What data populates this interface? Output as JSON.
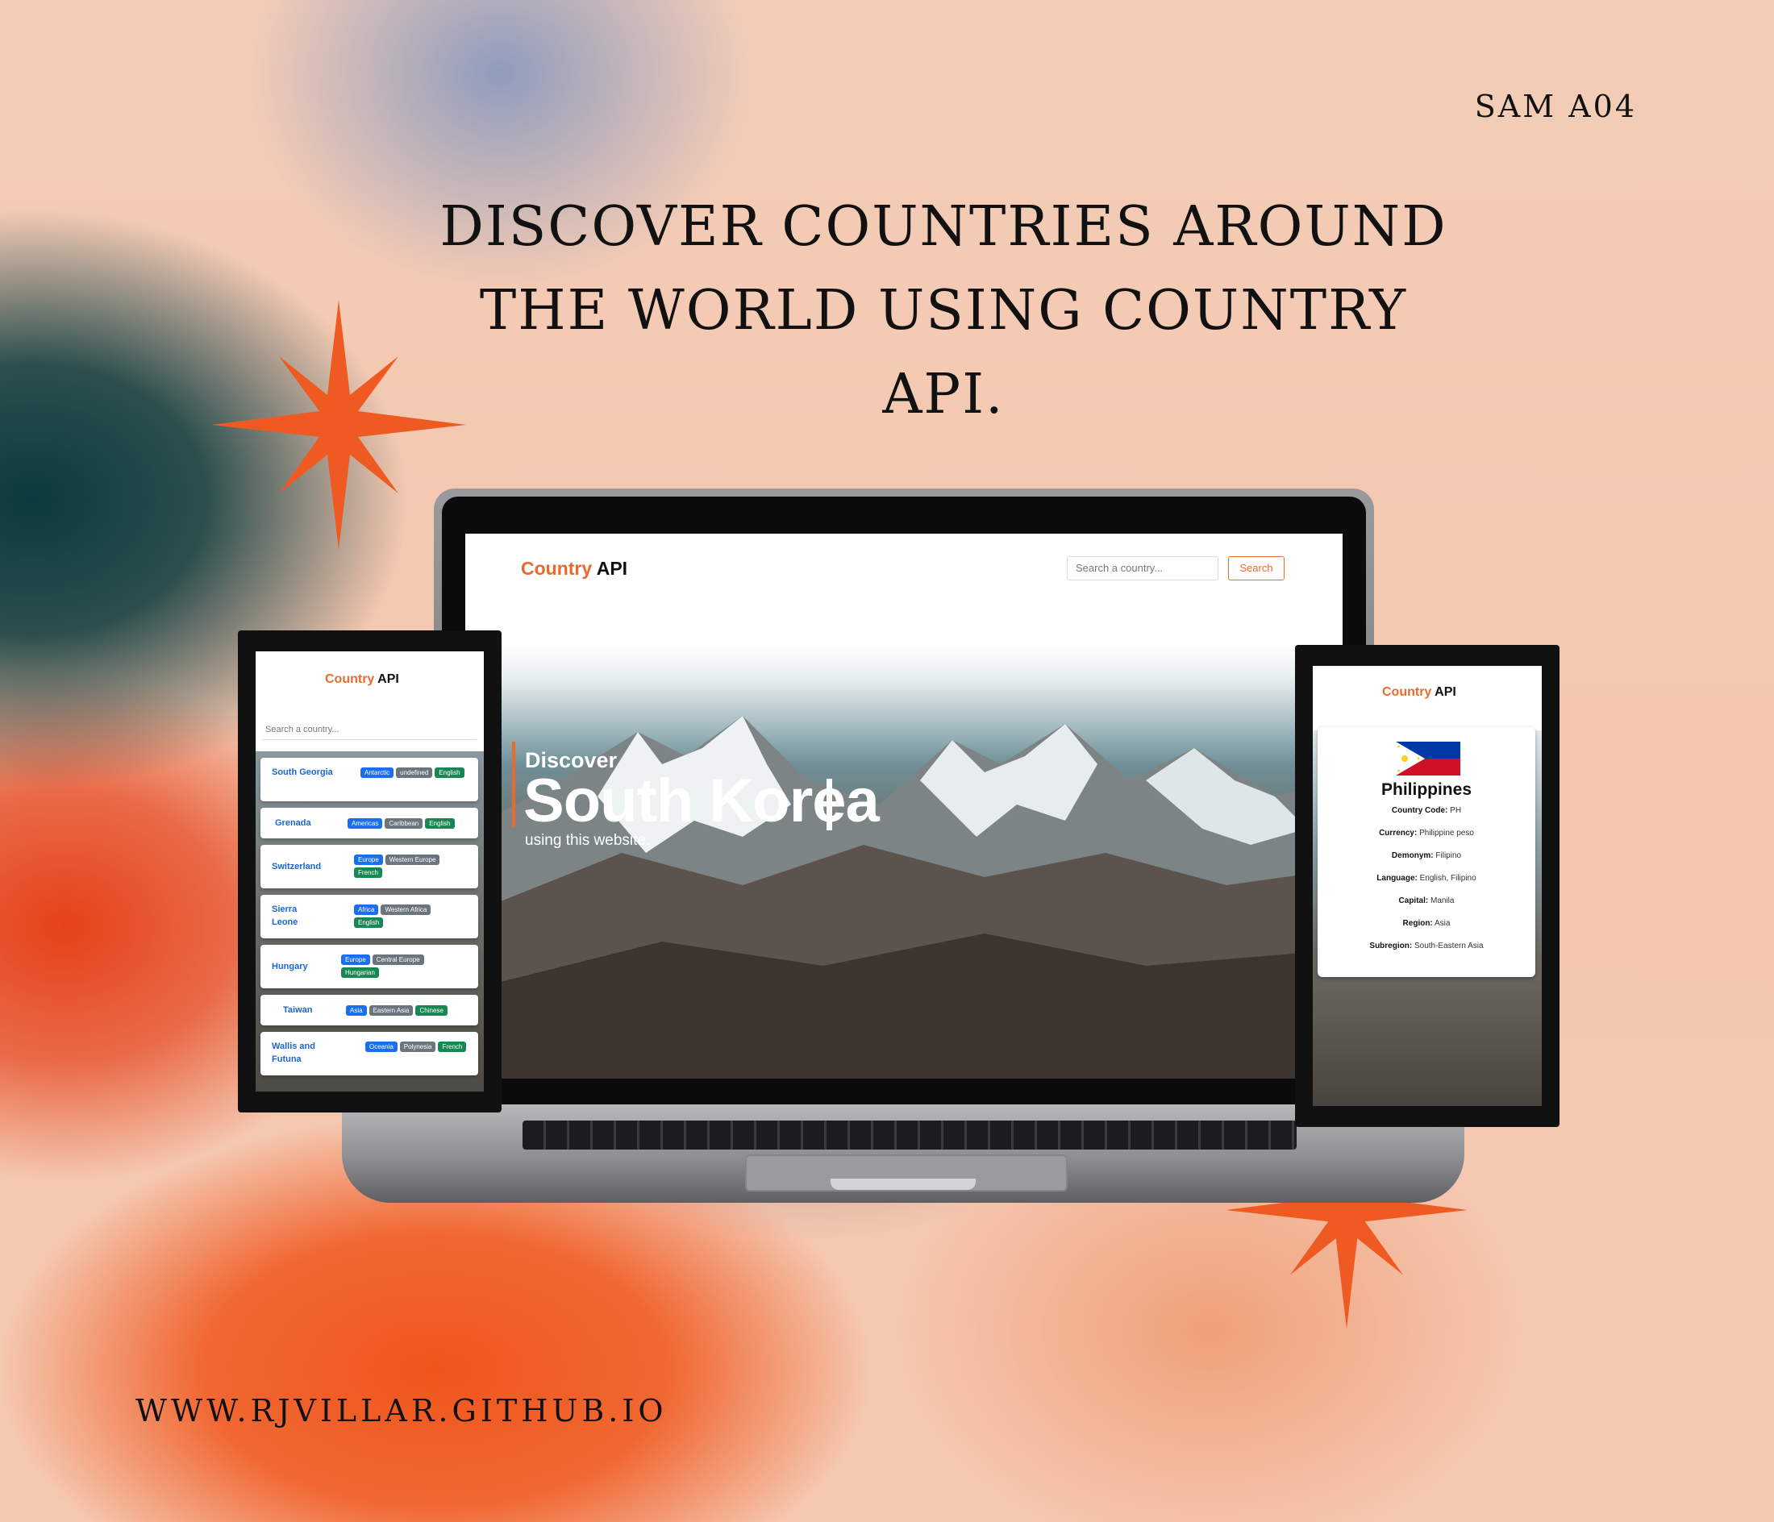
{
  "poster": {
    "tag": "SAM A04",
    "headline_line1": "DISCOVER COUNTRIES AROUND",
    "headline_line2": "THE WORLD USING COUNTRY API.",
    "url": "WWW.RJVILLAR.GITHUB.IO"
  },
  "colors": {
    "accent": "#e86a2c",
    "star": "#ee5a22",
    "link_blue": "#1a66d6"
  },
  "laptop": {
    "logo_accent": "Country",
    "logo_rest": " API",
    "search_placeholder": "Search a country...",
    "search_button": "Search",
    "hero_discover": "Discover",
    "hero_country": "South Korea",
    "hero_sub": "using this website."
  },
  "phone_left": {
    "logo_accent": "Country",
    "logo_rest": " API",
    "search_placeholder": "Search a country...",
    "countries": [
      {
        "name": "South Georgia",
        "tags": [
          "Antarctic",
          "undefined",
          "English"
        ]
      },
      {
        "name": "Grenada",
        "tags": [
          "Americas",
          "Caribbean",
          "English"
        ]
      },
      {
        "name": "Switzerland",
        "tags": [
          "Europe",
          "Western Europe",
          "French"
        ]
      },
      {
        "name": "Sierra Leone",
        "tags": [
          "Africa",
          "Western Africa",
          "English"
        ]
      },
      {
        "name": "Hungary",
        "tags": [
          "Europe",
          "Central Europe",
          "Hungarian"
        ]
      },
      {
        "name": "Taiwan",
        "tags": [
          "Asia",
          "Eastern Asia",
          "Chinese"
        ]
      },
      {
        "name": "Wallis and Futuna",
        "tags": [
          "Oceania",
          "Polynesia",
          "French"
        ]
      }
    ]
  },
  "phone_right": {
    "logo_accent": "Country",
    "logo_rest": " API",
    "country": "Philippines",
    "details": [
      {
        "label": "Country Code:",
        "value": "PH"
      },
      {
        "label": "Currency:",
        "value": "Philippine peso"
      },
      {
        "label": "Demonym:",
        "value": "Filipino"
      },
      {
        "label": "Language:",
        "value": "English, Filipino"
      },
      {
        "label": "Capital:",
        "value": "Manila"
      },
      {
        "label": "Region:",
        "value": "Asia"
      },
      {
        "label": "Subregion:",
        "value": "South-Eastern Asia"
      }
    ]
  }
}
